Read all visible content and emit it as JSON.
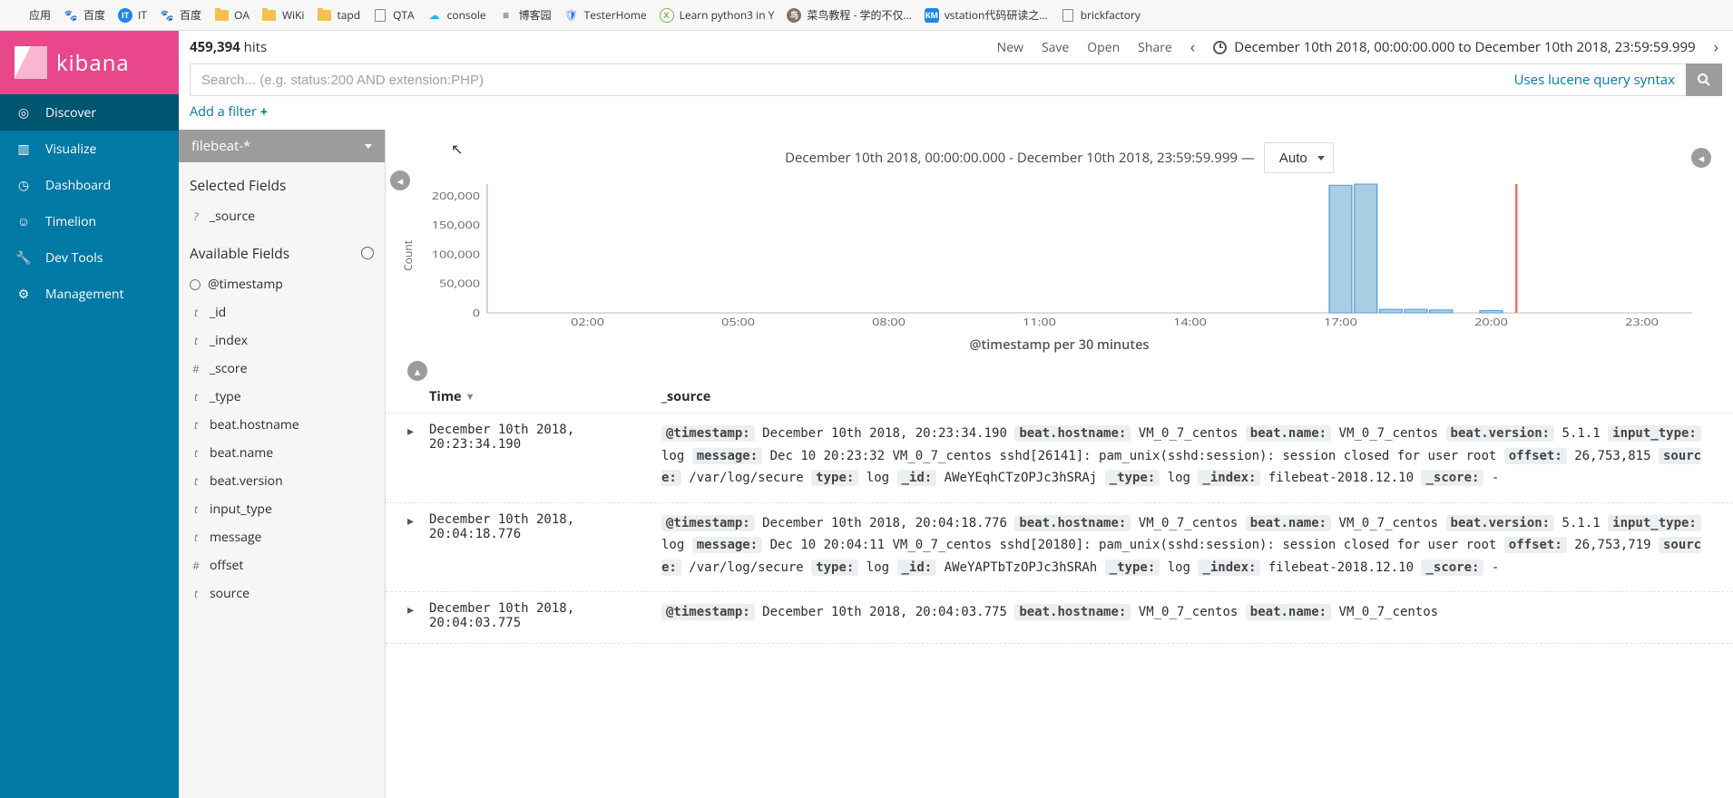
{
  "bookmarks": [
    {
      "label": "应用",
      "icon": "apps"
    },
    {
      "label": "百度",
      "icon": "baidu",
      "color": "#2b7bee"
    },
    {
      "label": "IT",
      "icon": "circ",
      "color": "#1e88e5"
    },
    {
      "label": "百度",
      "icon": "baidu",
      "color": "#2b7bee"
    },
    {
      "label": "OA",
      "icon": "folder"
    },
    {
      "label": "WiKi",
      "icon": "folder"
    },
    {
      "label": "tapd",
      "icon": "folder"
    },
    {
      "label": "QTA",
      "icon": "page"
    },
    {
      "label": "console",
      "icon": "cloud"
    },
    {
      "label": "博客园",
      "icon": "cnblog"
    },
    {
      "label": "TesterHome",
      "icon": "shield",
      "color": "#2b7bee"
    },
    {
      "label": "Learn python3 in Y",
      "icon": "xy",
      "color": "#7cb342"
    },
    {
      "label": "菜鸟教程 - 学的不仅…",
      "icon": "runoob",
      "color": "#8d6e63"
    },
    {
      "label": "vstation代码研读之…",
      "icon": "km",
      "color": "#1e88e5"
    },
    {
      "label": "brickfactory",
      "icon": "page"
    }
  ],
  "logo_text": "kibana",
  "nav": [
    {
      "label": "Discover",
      "icon": "compass",
      "active": true
    },
    {
      "label": "Visualize",
      "icon": "bar",
      "active": false
    },
    {
      "label": "Dashboard",
      "icon": "gauge",
      "active": false
    },
    {
      "label": "Timelion",
      "icon": "bear",
      "active": false
    },
    {
      "label": "Dev Tools",
      "icon": "wrench",
      "active": false
    },
    {
      "label": "Management",
      "icon": "gear",
      "active": false
    }
  ],
  "hits": {
    "count": "459,394",
    "suffix": "hits"
  },
  "top_actions": [
    "New",
    "Save",
    "Open",
    "Share"
  ],
  "time_range_display": "December 10th 2018, 00:00:00.000 to December 10th 2018, 23:59:59.999",
  "search_placeholder": "Search... (e.g. status:200 AND extension:PHP)",
  "lucene_hint": "Uses lucene query syntax",
  "add_filter": "Add a filter",
  "index_pattern": "filebeat-*",
  "selected_fields_title": "Selected Fields",
  "available_fields_title": "Available Fields",
  "selected_fields": [
    {
      "type": "?",
      "name": "_source"
    }
  ],
  "available_fields": [
    {
      "type": "clock",
      "name": "@timestamp"
    },
    {
      "type": "t",
      "name": "_id"
    },
    {
      "type": "t",
      "name": "_index"
    },
    {
      "type": "#",
      "name": "_score"
    },
    {
      "type": "t",
      "name": "_type"
    },
    {
      "type": "t",
      "name": "beat.hostname"
    },
    {
      "type": "t",
      "name": "beat.name"
    },
    {
      "type": "t",
      "name": "beat.version"
    },
    {
      "type": "t",
      "name": "input_type"
    },
    {
      "type": "t",
      "name": "message"
    },
    {
      "type": "#",
      "name": "offset"
    },
    {
      "type": "t",
      "name": "source"
    }
  ],
  "hist_range_text": "December 10th 2018, 00:00:00.000 - December 10th 2018, 23:59:59.999 —",
  "interval": "Auto",
  "yaxis": "Count",
  "xaxis_caption": "@timestamp per 30 minutes",
  "columns": {
    "time": "Time",
    "source": "_source"
  },
  "chart_data": {
    "type": "bar",
    "xlabel": "@timestamp per 30 minutes",
    "ylabel": "Count",
    "ylim": [
      0,
      220000
    ],
    "y_ticks": [
      0,
      50000,
      100000,
      150000,
      200000
    ],
    "x_tick_labels": [
      "02:00",
      "05:00",
      "08:00",
      "11:00",
      "14:00",
      "17:00",
      "20:00",
      "23:00"
    ],
    "x_domain_hours": [
      0,
      24
    ],
    "marker_hour": 20.5,
    "bars": [
      {
        "hour": 17.0,
        "count": 218000
      },
      {
        "hour": 17.5,
        "count": 220000
      },
      {
        "hour": 18.0,
        "count": 6000
      },
      {
        "hour": 18.5,
        "count": 6000
      },
      {
        "hour": 19.0,
        "count": 5000
      },
      {
        "hour": 20.0,
        "count": 4000
      }
    ]
  },
  "docs": [
    {
      "time": "December 10th 2018, 20:23:34.190",
      "kv": [
        [
          "@timestamp:",
          "December 10th 2018, 20:23:34.190"
        ],
        [
          "beat.hostname:",
          "VM_0_7_centos"
        ],
        [
          "beat.name:",
          "VM_0_7_centos"
        ],
        [
          "beat.version:",
          "5.1.1"
        ],
        [
          "input_type:",
          "log"
        ],
        [
          "message:",
          "Dec 10 20:23:32 VM_0_7_centos sshd[26141]: pam_unix(sshd:session): session closed for user root"
        ],
        [
          "offset:",
          "26,753,815"
        ],
        [
          "source:",
          "/var/log/secure"
        ],
        [
          "type:",
          "log"
        ],
        [
          "_id:",
          "AWeYEqhCTzOPJc3hSRAj"
        ],
        [
          "_type:",
          "log"
        ],
        [
          "_index:",
          "filebeat-2018.12.10"
        ],
        [
          "_score:",
          " - "
        ]
      ]
    },
    {
      "time": "December 10th 2018, 20:04:18.776",
      "kv": [
        [
          "@timestamp:",
          "December 10th 2018, 20:04:18.776"
        ],
        [
          "beat.hostname:",
          "VM_0_7_centos"
        ],
        [
          "beat.name:",
          "VM_0_7_centos"
        ],
        [
          "beat.version:",
          "5.1.1"
        ],
        [
          "input_type:",
          "log"
        ],
        [
          "message:",
          "Dec 10 20:04:11 VM_0_7_centos sshd[20180]: pam_unix(sshd:session): session closed for user root"
        ],
        [
          "offset:",
          "26,753,719"
        ],
        [
          "source:",
          "/var/log/secure"
        ],
        [
          "type:",
          "log"
        ],
        [
          "_id:",
          "AWeYAPTbTzOPJc3hSRAh"
        ],
        [
          "_type:",
          "log"
        ],
        [
          "_index:",
          "filebeat-2018.12.10"
        ],
        [
          "_score:",
          " - "
        ]
      ]
    },
    {
      "time": "December 10th 2018, 20:04:03.775",
      "kv": [
        [
          "@timestamp:",
          "December 10th 2018, 20:04:03.775"
        ],
        [
          "beat.hostname:",
          "VM_0_7_centos"
        ],
        [
          "beat.name:",
          "VM_0_7_centos"
        ]
      ]
    }
  ],
  "colors": {
    "brand_pink": "#e8488b",
    "nav_blue": "#0079a5",
    "nav_blue_dark": "#005571",
    "link": "#0079a5",
    "bar_fill": "#a8cee3",
    "bar_stroke": "#5b9bd5"
  }
}
